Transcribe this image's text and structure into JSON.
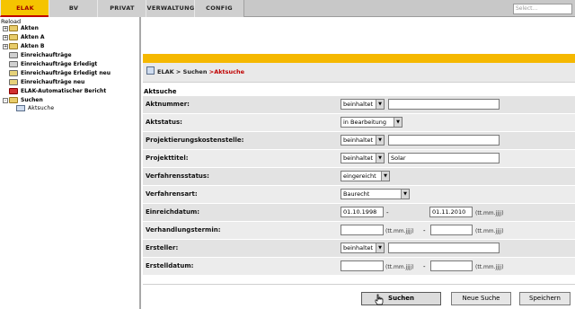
{
  "top_tabs": [
    {
      "label": "ELAK",
      "active": true
    },
    {
      "label": "BV",
      "active": false
    },
    {
      "label": "PRIVAT",
      "active": false
    },
    {
      "label": "VERWALTUNG",
      "active": false
    },
    {
      "label": "CONFIG",
      "active": false
    }
  ],
  "search": {
    "placeholder": "Select..."
  },
  "sidebar": {
    "reload": "Reload",
    "items": [
      {
        "label": "Akten",
        "expander": "+",
        "icon": "folder-icon"
      },
      {
        "label": "Akten A",
        "expander": "+",
        "icon": "folder-icon"
      },
      {
        "label": "Akten B",
        "expander": "+",
        "icon": "folder-icon"
      },
      {
        "label": "Einreichaufträge",
        "expander": "",
        "icon": "tray-icon"
      },
      {
        "label": "Einreichaufträge Erledigt",
        "expander": "",
        "icon": "tray-icon"
      },
      {
        "label": "Einreichaufträge Erledigt neu",
        "expander": "",
        "icon": "tray-icon"
      },
      {
        "label": "Einreichaufträge neu",
        "expander": "",
        "icon": "tray-icon"
      },
      {
        "label": "ELAK-Automatischer Bericht",
        "expander": "",
        "icon": "report-icon"
      },
      {
        "label": "Suchen",
        "expander": "-",
        "icon": "folder-icon"
      }
    ],
    "sub_item": {
      "label": "Aktsuche",
      "icon": "search-icon"
    }
  },
  "breadcrumb": {
    "root": "ELAK",
    "sep1": ">",
    "mid": "Suchen",
    "sep2": ">",
    "current": "Aktsuche"
  },
  "section_title": "Aktsuche",
  "form": {
    "aktnummer": {
      "label": "Aktnummer:",
      "operator": "beinhaltet",
      "value": ""
    },
    "aktstatus": {
      "label": "Aktstatus:",
      "value": "in Bearbeitung"
    },
    "projektierungskostenstelle": {
      "label": "Projektierungskostenstelle:",
      "operator": "beinhaltet",
      "value": ""
    },
    "projekttitel": {
      "label": "Projekttitel:",
      "operator": "beinhaltet",
      "value": "Solar"
    },
    "verfahrensstatus": {
      "label": "Verfahrensstatus:",
      "value": "eingereicht"
    },
    "verfahrensart": {
      "label": "Verfahrensart:",
      "value": "Baurecht"
    },
    "einreichdatum": {
      "label": "Einreichdatum:",
      "from": "01.10.1998",
      "to": "01.11.2010",
      "hint": "(tt.mm.jjjj)",
      "dash": "-"
    },
    "verhandlungstermin": {
      "label": "Verhandlungstermin:",
      "from": "",
      "to": "",
      "hint": "(tt.mm.jjjj)",
      "dash": "-"
    },
    "ersteller": {
      "label": "Ersteller:",
      "operator": "beinhaltet",
      "value": ""
    },
    "erstelldatum": {
      "label": "Erstelldatum:",
      "from": "",
      "to": "",
      "hint": "(tt.mm.jjjj)",
      "dash": "-"
    }
  },
  "buttons": {
    "search": "Suchen",
    "new_search": "Neue Suche",
    "save": "Speichern"
  },
  "colors": {
    "accent_yellow": "#f5b800",
    "active_tab_text": "#c00000"
  }
}
